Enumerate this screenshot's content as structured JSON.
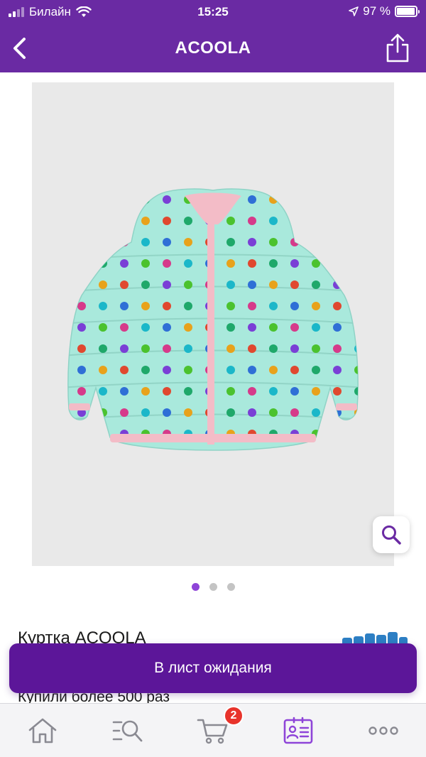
{
  "status_bar": {
    "carrier": "Билайн",
    "time": "15:25",
    "battery": "97 %",
    "battery_level": 0.97
  },
  "navbar": {
    "title": "ACOOLA"
  },
  "gallery": {
    "page_count": 3,
    "active_index": 0
  },
  "product": {
    "title": "Куртка ACOOLA",
    "purchases": "Купили более 500 раз"
  },
  "cta": {
    "label": "В лист ожидания"
  },
  "tabbar": {
    "items": [
      {
        "icon": "home-icon"
      },
      {
        "icon": "search-icon"
      },
      {
        "icon": "cart-icon"
      },
      {
        "icon": "profile-card-icon"
      },
      {
        "icon": "more-icon"
      }
    ],
    "cart_badge": "2"
  },
  "colors": {
    "brand": "#6a2aa3",
    "cta": "#5c1699",
    "accent": "#8e44d8",
    "badge": "#e8332b"
  }
}
